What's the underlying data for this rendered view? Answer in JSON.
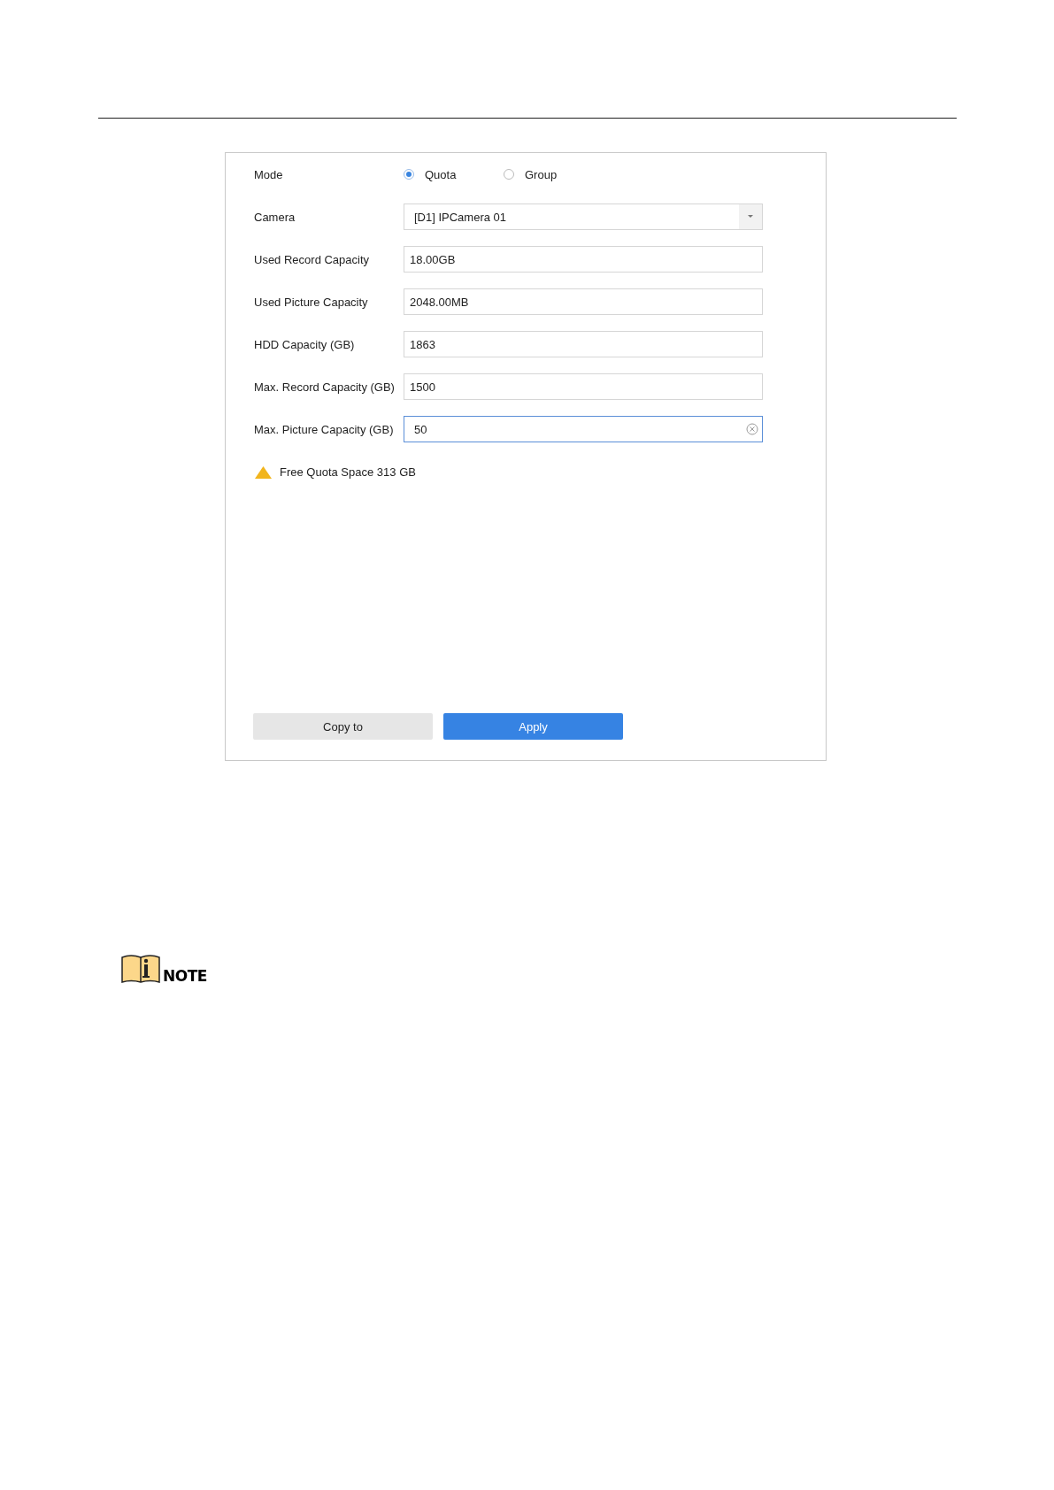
{
  "mode": {
    "label": "Mode",
    "options": [
      {
        "label": "Quota",
        "selected": true
      },
      {
        "label": "Group",
        "selected": false
      }
    ]
  },
  "fields": [
    {
      "label": "Camera",
      "kind": "select",
      "value": "[D1] IPCamera 01"
    },
    {
      "label": "Used Record Capacity",
      "kind": "text",
      "value": "18.00GB",
      "focused": false
    },
    {
      "label": "Used Picture Capacity",
      "kind": "text",
      "value": "2048.00MB",
      "focused": false
    },
    {
      "label": "HDD Capacity (GB)",
      "kind": "text",
      "value": "1863",
      "focused": false
    },
    {
      "label": "Max. Record Capacity (GB)",
      "kind": "text",
      "value": "1500",
      "focused": false
    },
    {
      "label": "Max. Picture Capacity (GB)",
      "kind": "text",
      "value": "50",
      "focused": true
    }
  ],
  "warning": "Free Quota Space 313 GB",
  "buttons": [
    {
      "label": "Copy to",
      "kind": "secondary"
    },
    {
      "label": "Apply",
      "kind": "primary"
    }
  ],
  "note": {
    "label": "NOTE"
  }
}
